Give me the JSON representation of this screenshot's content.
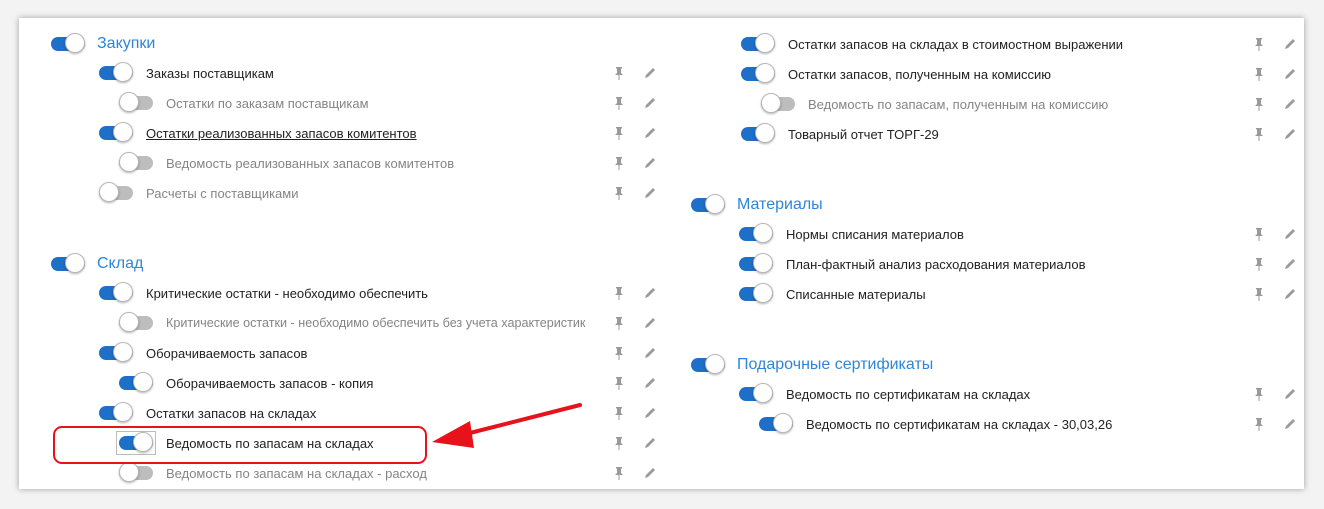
{
  "groups": [
    {
      "title": "Закупки",
      "items": [
        {
          "label": "Заказы поставщикам",
          "on": true,
          "level": 1
        },
        {
          "label": "Остатки по заказам поставщикам",
          "on": false,
          "level": 2
        },
        {
          "label": "Остатки реализованных запасов комитентов",
          "on": true,
          "level": 1,
          "link": true
        },
        {
          "label": "Ведомость реализованных запасов комитентов",
          "on": false,
          "level": 2
        },
        {
          "label": "Расчеты с поставщиками",
          "on": false,
          "level": 1
        }
      ]
    },
    {
      "title": "Склад",
      "items": [
        {
          "label": "Критические остатки - необходимо обеспечить",
          "on": true,
          "level": 1
        },
        {
          "label": "Критические остатки - необходимо обеспечить без учета характеристик",
          "on": false,
          "level": 2
        },
        {
          "label": "Оборачиваемость запасов",
          "on": true,
          "level": 1
        },
        {
          "label": "Оборачиваемость запасов - копия",
          "on": true,
          "level": 2
        },
        {
          "label": "Остатки запасов на складах",
          "on": true,
          "level": 1
        },
        {
          "label": "Ведомость по запасам на складах",
          "on": true,
          "level": 2,
          "highlighted": true
        },
        {
          "label": "Ведомость по запасам на складах - расход",
          "on": false,
          "level": 2
        }
      ]
    },
    {
      "title": "",
      "items": [
        {
          "label": "Остатки запасов на складах в стоимостном выражении",
          "on": true,
          "level": 1
        },
        {
          "label": "Остатки запасов, полученным на комиссию",
          "on": true,
          "level": 1
        },
        {
          "label": "Ведомость по запасам, полученным на комиссию",
          "on": false,
          "level": 2
        },
        {
          "label": "Товарный отчет ТОРГ-29",
          "on": true,
          "level": 1
        }
      ]
    },
    {
      "title": "Материалы",
      "items": [
        {
          "label": "Нормы списания материалов",
          "on": true,
          "level": 1
        },
        {
          "label": "План-фактный анализ расходования материалов",
          "on": true,
          "level": 1
        },
        {
          "label": "Списанные материалы",
          "on": true,
          "level": 1
        }
      ]
    },
    {
      "title": "Подарочные сертификаты",
      "items": [
        {
          "label": "Ведомость по сертификатам на складах",
          "on": true,
          "level": 1
        },
        {
          "label": "Ведомость по сертификатам на складах - 30,03,26",
          "on": true,
          "level": 2
        }
      ]
    }
  ],
  "colors": {
    "accent": "#2d86d8",
    "toggle_on": "#1e6fc8",
    "toggle_off": "#bdbdbd",
    "annotation": "#e8131a"
  },
  "icons": {
    "pin": "pin-icon",
    "edit": "pencil-icon"
  }
}
